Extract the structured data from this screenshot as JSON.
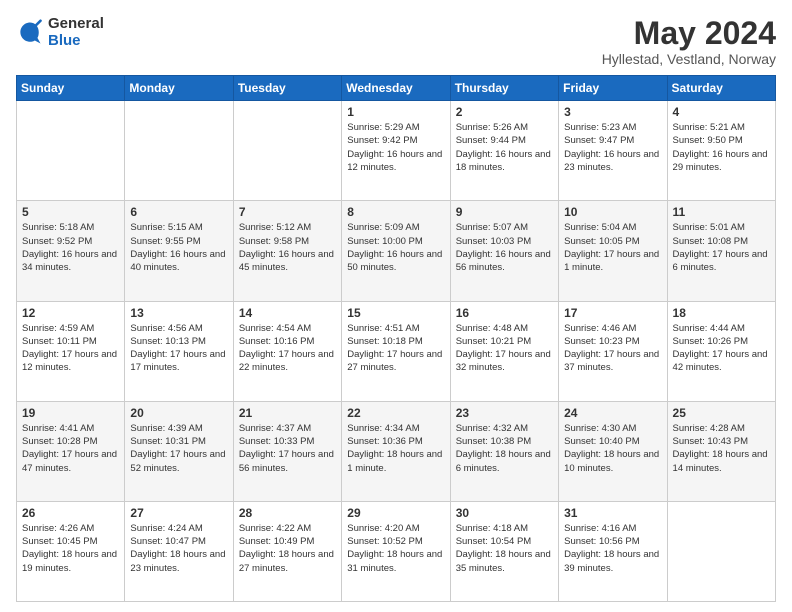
{
  "logo": {
    "general": "General",
    "blue": "Blue"
  },
  "title": {
    "month_year": "May 2024",
    "location": "Hyllestad, Vestland, Norway"
  },
  "weekdays": [
    "Sunday",
    "Monday",
    "Tuesday",
    "Wednesday",
    "Thursday",
    "Friday",
    "Saturday"
  ],
  "weeks": [
    [
      {
        "day": "",
        "info": ""
      },
      {
        "day": "",
        "info": ""
      },
      {
        "day": "",
        "info": ""
      },
      {
        "day": "1",
        "info": "Sunrise: 5:29 AM\nSunset: 9:42 PM\nDaylight: 16 hours\nand 12 minutes."
      },
      {
        "day": "2",
        "info": "Sunrise: 5:26 AM\nSunset: 9:44 PM\nDaylight: 16 hours\nand 18 minutes."
      },
      {
        "day": "3",
        "info": "Sunrise: 5:23 AM\nSunset: 9:47 PM\nDaylight: 16 hours\nand 23 minutes."
      },
      {
        "day": "4",
        "info": "Sunrise: 5:21 AM\nSunset: 9:50 PM\nDaylight: 16 hours\nand 29 minutes."
      }
    ],
    [
      {
        "day": "5",
        "info": "Sunrise: 5:18 AM\nSunset: 9:52 PM\nDaylight: 16 hours\nand 34 minutes."
      },
      {
        "day": "6",
        "info": "Sunrise: 5:15 AM\nSunset: 9:55 PM\nDaylight: 16 hours\nand 40 minutes."
      },
      {
        "day": "7",
        "info": "Sunrise: 5:12 AM\nSunset: 9:58 PM\nDaylight: 16 hours\nand 45 minutes."
      },
      {
        "day": "8",
        "info": "Sunrise: 5:09 AM\nSunset: 10:00 PM\nDaylight: 16 hours\nand 50 minutes."
      },
      {
        "day": "9",
        "info": "Sunrise: 5:07 AM\nSunset: 10:03 PM\nDaylight: 16 hours\nand 56 minutes."
      },
      {
        "day": "10",
        "info": "Sunrise: 5:04 AM\nSunset: 10:05 PM\nDaylight: 17 hours\nand 1 minute."
      },
      {
        "day": "11",
        "info": "Sunrise: 5:01 AM\nSunset: 10:08 PM\nDaylight: 17 hours\nand 6 minutes."
      }
    ],
    [
      {
        "day": "12",
        "info": "Sunrise: 4:59 AM\nSunset: 10:11 PM\nDaylight: 17 hours\nand 12 minutes."
      },
      {
        "day": "13",
        "info": "Sunrise: 4:56 AM\nSunset: 10:13 PM\nDaylight: 17 hours\nand 17 minutes."
      },
      {
        "day": "14",
        "info": "Sunrise: 4:54 AM\nSunset: 10:16 PM\nDaylight: 17 hours\nand 22 minutes."
      },
      {
        "day": "15",
        "info": "Sunrise: 4:51 AM\nSunset: 10:18 PM\nDaylight: 17 hours\nand 27 minutes."
      },
      {
        "day": "16",
        "info": "Sunrise: 4:48 AM\nSunset: 10:21 PM\nDaylight: 17 hours\nand 32 minutes."
      },
      {
        "day": "17",
        "info": "Sunrise: 4:46 AM\nSunset: 10:23 PM\nDaylight: 17 hours\nand 37 minutes."
      },
      {
        "day": "18",
        "info": "Sunrise: 4:44 AM\nSunset: 10:26 PM\nDaylight: 17 hours\nand 42 minutes."
      }
    ],
    [
      {
        "day": "19",
        "info": "Sunrise: 4:41 AM\nSunset: 10:28 PM\nDaylight: 17 hours\nand 47 minutes."
      },
      {
        "day": "20",
        "info": "Sunrise: 4:39 AM\nSunset: 10:31 PM\nDaylight: 17 hours\nand 52 minutes."
      },
      {
        "day": "21",
        "info": "Sunrise: 4:37 AM\nSunset: 10:33 PM\nDaylight: 17 hours\nand 56 minutes."
      },
      {
        "day": "22",
        "info": "Sunrise: 4:34 AM\nSunset: 10:36 PM\nDaylight: 18 hours\nand 1 minute."
      },
      {
        "day": "23",
        "info": "Sunrise: 4:32 AM\nSunset: 10:38 PM\nDaylight: 18 hours\nand 6 minutes."
      },
      {
        "day": "24",
        "info": "Sunrise: 4:30 AM\nSunset: 10:40 PM\nDaylight: 18 hours\nand 10 minutes."
      },
      {
        "day": "25",
        "info": "Sunrise: 4:28 AM\nSunset: 10:43 PM\nDaylight: 18 hours\nand 14 minutes."
      }
    ],
    [
      {
        "day": "26",
        "info": "Sunrise: 4:26 AM\nSunset: 10:45 PM\nDaylight: 18 hours\nand 19 minutes."
      },
      {
        "day": "27",
        "info": "Sunrise: 4:24 AM\nSunset: 10:47 PM\nDaylight: 18 hours\nand 23 minutes."
      },
      {
        "day": "28",
        "info": "Sunrise: 4:22 AM\nSunset: 10:49 PM\nDaylight: 18 hours\nand 27 minutes."
      },
      {
        "day": "29",
        "info": "Sunrise: 4:20 AM\nSunset: 10:52 PM\nDaylight: 18 hours\nand 31 minutes."
      },
      {
        "day": "30",
        "info": "Sunrise: 4:18 AM\nSunset: 10:54 PM\nDaylight: 18 hours\nand 35 minutes."
      },
      {
        "day": "31",
        "info": "Sunrise: 4:16 AM\nSunset: 10:56 PM\nDaylight: 18 hours\nand 39 minutes."
      },
      {
        "day": "",
        "info": ""
      }
    ]
  ]
}
